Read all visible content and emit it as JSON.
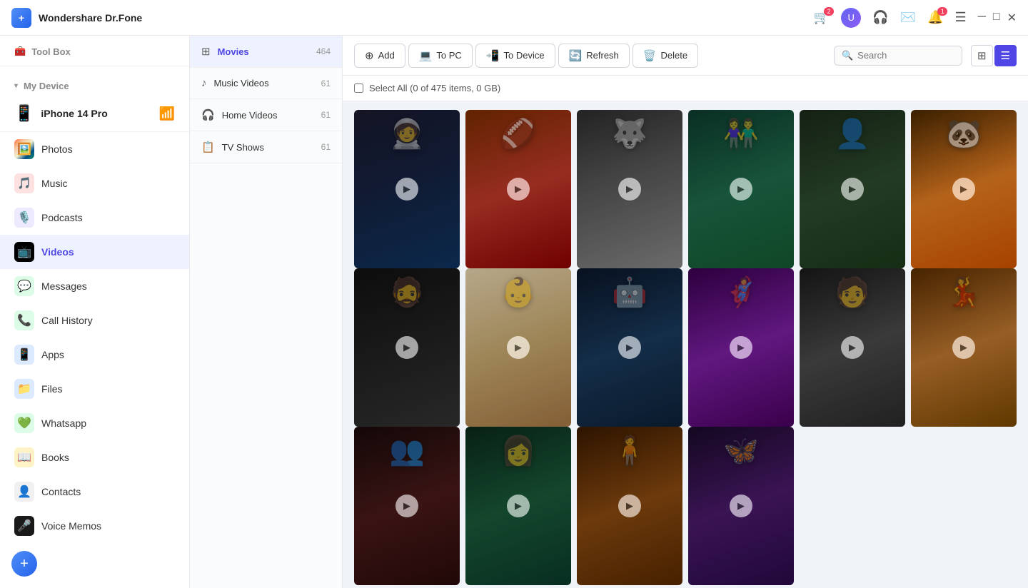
{
  "app": {
    "name": "Wondershare Dr.Fone"
  },
  "titlebar": {
    "cart_badge": "2",
    "notification_badge": "1"
  },
  "sidebar": {
    "toolbox_label": "Tool Box",
    "mydevice_label": "My Device",
    "device_name": "iPhone 14 Pro",
    "items": [
      {
        "id": "photos",
        "label": "Photos",
        "icon": "🖼️",
        "icon_class": "icon-photos"
      },
      {
        "id": "music",
        "label": "Music",
        "icon": "🎵",
        "icon_class": "icon-music"
      },
      {
        "id": "podcasts",
        "label": "Podcasts",
        "icon": "🎙️",
        "icon_class": "icon-podcasts"
      },
      {
        "id": "videos",
        "label": "Videos",
        "icon": "📺",
        "icon_class": "icon-videos",
        "active": true
      },
      {
        "id": "messages",
        "label": "Messages",
        "icon": "💬",
        "icon_class": "icon-messages"
      },
      {
        "id": "callhistory",
        "label": "Call History",
        "icon": "📞",
        "icon_class": "icon-callhistory"
      },
      {
        "id": "apps",
        "label": "Apps",
        "icon": "📱",
        "icon_class": "icon-apps"
      },
      {
        "id": "files",
        "label": "Files",
        "icon": "📁",
        "icon_class": "icon-files"
      },
      {
        "id": "whatsapp",
        "label": "Whatsapp",
        "icon": "💚",
        "icon_class": "icon-whatsapp"
      },
      {
        "id": "books",
        "label": "Books",
        "icon": "📖",
        "icon_class": "icon-books"
      },
      {
        "id": "contacts",
        "label": "Contacts",
        "icon": "👤",
        "icon_class": "icon-contacts"
      },
      {
        "id": "voicememos",
        "label": "Voice Memos",
        "icon": "🎤",
        "icon_class": "icon-voicememos"
      }
    ]
  },
  "video_categories": [
    {
      "id": "movies",
      "label": "Movies",
      "count": "464",
      "active": true,
      "icon": "⊞"
    },
    {
      "id": "musicvideos",
      "label": "Music Videos",
      "count": "61",
      "active": false,
      "icon": "♪"
    },
    {
      "id": "homevideos",
      "label": "Home Videos",
      "count": "61",
      "active": false,
      "icon": "🎧"
    },
    {
      "id": "tvshows",
      "label": "TV Shows",
      "count": "61",
      "active": false,
      "icon": "📋"
    }
  ],
  "toolbar": {
    "add_label": "Add",
    "topc_label": "To PC",
    "todevice_label": "To Device",
    "refresh_label": "Refresh",
    "delete_label": "Delete",
    "search_placeholder": "Search",
    "select_all_label": "Select All (0 of 475 items, 0 GB)"
  },
  "movies": [
    {
      "id": 0,
      "color_class": "movie-0",
      "silhouette": "🧑‍🚀"
    },
    {
      "id": 1,
      "color_class": "movie-1",
      "silhouette": "🏈"
    },
    {
      "id": 2,
      "color_class": "movie-2",
      "silhouette": "🐺"
    },
    {
      "id": 3,
      "color_class": "movie-3",
      "silhouette": "👫"
    },
    {
      "id": 4,
      "color_class": "movie-4",
      "silhouette": "👤"
    },
    {
      "id": 5,
      "color_class": "movie-5",
      "silhouette": "🐼"
    },
    {
      "id": 6,
      "color_class": "movie-6",
      "silhouette": "🧔"
    },
    {
      "id": 7,
      "color_class": "movie-7",
      "silhouette": "👶"
    },
    {
      "id": 8,
      "color_class": "movie-8",
      "silhouette": "🤖"
    },
    {
      "id": 9,
      "color_class": "movie-9",
      "silhouette": "🦸"
    },
    {
      "id": 10,
      "color_class": "movie-10",
      "silhouette": "🧑"
    },
    {
      "id": 11,
      "color_class": "movie-11",
      "silhouette": "💃"
    },
    {
      "id": 12,
      "color_class": "movie-12",
      "silhouette": "👥"
    },
    {
      "id": 13,
      "color_class": "movie-13",
      "silhouette": "👩"
    },
    {
      "id": 14,
      "color_class": "movie-14",
      "silhouette": "🧍"
    },
    {
      "id": 15,
      "color_class": "movie-15",
      "silhouette": "🦋"
    }
  ]
}
